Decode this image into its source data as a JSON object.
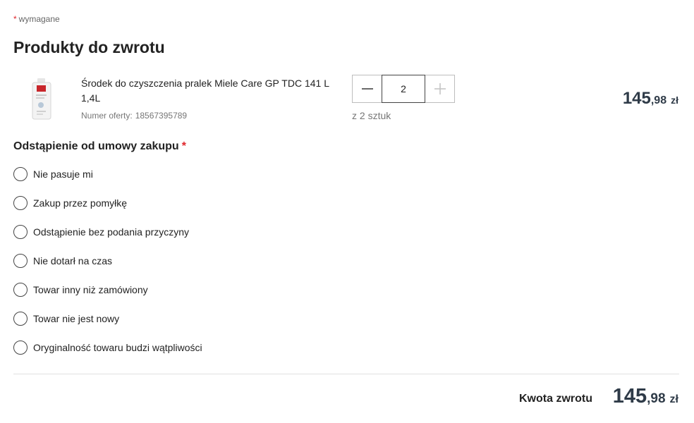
{
  "required_note": {
    "star": "*",
    "text": "wymagane"
  },
  "section_title": "Produkty do zwrotu",
  "product": {
    "name": "Środek do czyszczenia pralek Miele Care GP TDC 141 L 1,4L",
    "offer_label": "Numer oferty:",
    "offer_number": "18567395789",
    "quantity": "2",
    "stock_info": "z 2 sztuk",
    "price": {
      "int": "145",
      "dec": ",98",
      "currency": "zł"
    },
    "image_icon": "product-bottle-icon"
  },
  "reasons": {
    "title": "Odstąpienie od umowy zakupu",
    "star": "*",
    "options": [
      "Nie pasuje mi",
      "Zakup przez pomyłkę",
      "Odstąpienie bez podania przyczyny",
      "Nie dotarł na czas",
      "Towar inny niż zamówiony",
      "Towar nie jest nowy",
      "Oryginalność towaru budzi wątpliwości"
    ]
  },
  "total": {
    "label": "Kwota zwrotu",
    "int": "145",
    "dec": ",98",
    "currency": "zł"
  },
  "colors": {
    "accent_red": "#e0262b",
    "price": "#2f3b48",
    "muted": "#767676"
  }
}
